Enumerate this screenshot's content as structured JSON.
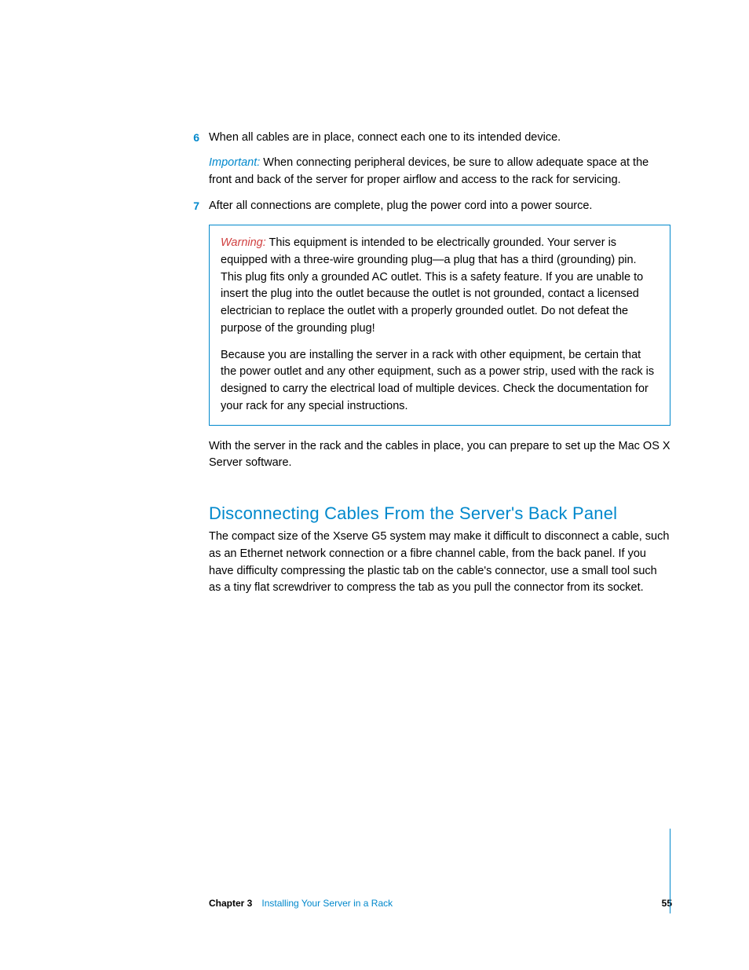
{
  "steps": {
    "step6": {
      "number": "6",
      "text": "When all cables are in place, connect each one to its intended device."
    },
    "important": {
      "label": "Important:",
      "text": "  When connecting peripheral devices, be sure to allow adequate space at the front and back of the server for proper airflow and access to the rack for servicing."
    },
    "step7": {
      "number": "7",
      "text": "After all connections are complete, plug the power cord into a power source."
    }
  },
  "warning": {
    "label": "Warning:",
    "para1": "  This equipment is intended to be electrically grounded. Your server is equipped with a three-wire grounding plug—a plug that has a third (grounding) pin. This plug fits only a grounded AC outlet. This is a safety feature. If you are unable to insert the plug into the outlet because the outlet is not grounded, contact a licensed electrician to replace the outlet with a properly grounded outlet. Do not defeat the purpose of the grounding plug!",
    "para2": "Because you are installing the server in a rack with other equipment, be certain that the power outlet and any other equipment, such as a power strip, used with the rack is designed to carry the electrical load of multiple devices. Check the documentation for your rack for any special instructions."
  },
  "closing": "With the server in the rack and the cables in place, you can prepare to set up the Mac OS X Server software.",
  "section": {
    "heading": "Disconnecting Cables From the Server's Back Panel",
    "para": "The compact size of the Xserve G5 system may make it difficult to disconnect a cable, such as an Ethernet network connection or a fibre channel cable, from the back panel. If you have difficulty compressing the plastic tab on the cable's connector, use a small tool such as a tiny flat screwdriver to compress the tab as you pull the connector from its socket."
  },
  "footer": {
    "chapter_label": "Chapter 3",
    "chapter_title": "Installing Your Server in a Rack",
    "page_number": "55"
  }
}
